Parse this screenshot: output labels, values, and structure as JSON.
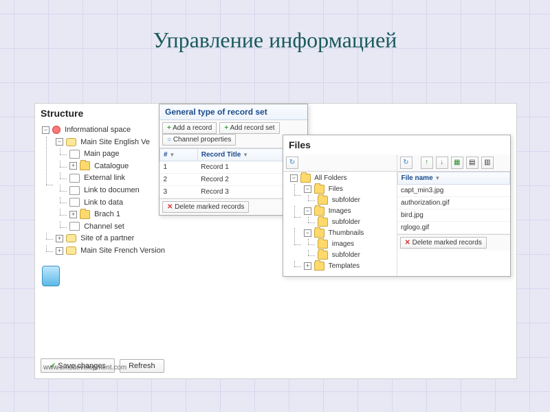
{
  "slide_title": "Управление информацией",
  "footer": "www.cmsdevelopment.com",
  "structure": {
    "title": "Structure",
    "tree": [
      {
        "icon": "net",
        "label": "Informational space",
        "exp": "-",
        "children": [
          {
            "icon": "db",
            "label": "Main Site English Ve",
            "exp": "-",
            "children": [
              {
                "icon": "page",
                "label": "Main page"
              },
              {
                "icon": "folder",
                "label": "Catalogue",
                "exp": "+"
              },
              {
                "icon": "page",
                "label": "External link"
              },
              {
                "icon": "page",
                "label": "Link to documen"
              },
              {
                "icon": "page",
                "label": "Link to data"
              },
              {
                "icon": "folder",
                "label": "Brach 1",
                "exp": "+"
              },
              {
                "icon": "page",
                "label": "Channel set"
              }
            ]
          },
          {
            "icon": "db",
            "label": "Site of a partner",
            "exp": "+"
          },
          {
            "icon": "db",
            "label": "Main Site French Version",
            "exp": "+"
          }
        ]
      }
    ],
    "save": "Save changes",
    "refresh": "Refresh"
  },
  "records": {
    "title": "General type of record set",
    "add_record": "Add a record",
    "add_set": "Add record set",
    "channel_props": "Channel properties",
    "col_num": "#",
    "col_title": "Record Title",
    "rows": [
      {
        "n": "1",
        "t": "Record 1"
      },
      {
        "n": "2",
        "t": "Record 2"
      },
      {
        "n": "3",
        "t": "Record 3"
      }
    ],
    "delete": "Delete marked records"
  },
  "files": {
    "title": "Files",
    "tree": [
      {
        "icon": "folder",
        "label": "All Folders",
        "exp": "-",
        "children": [
          {
            "icon": "folder",
            "label": "Files",
            "exp": "-",
            "children": [
              {
                "icon": "folder",
                "label": "subfolder"
              }
            ]
          },
          {
            "icon": "folder",
            "label": "Images",
            "exp": "-",
            "children": [
              {
                "icon": "folder",
                "label": "subfolder"
              }
            ]
          },
          {
            "icon": "folder",
            "label": "Thumbnails",
            "exp": "-",
            "children": [
              {
                "icon": "folder",
                "label": "images"
              },
              {
                "icon": "folder",
                "label": "subfolder"
              }
            ]
          },
          {
            "icon": "folder",
            "label": "Templates",
            "exp": "+"
          }
        ]
      }
    ],
    "col_file": "File name",
    "rows": [
      "capt_min3.jpg",
      "authorization.gif",
      "bird.jpg",
      "rglogo.gif"
    ],
    "delete": "Delete marked records"
  }
}
